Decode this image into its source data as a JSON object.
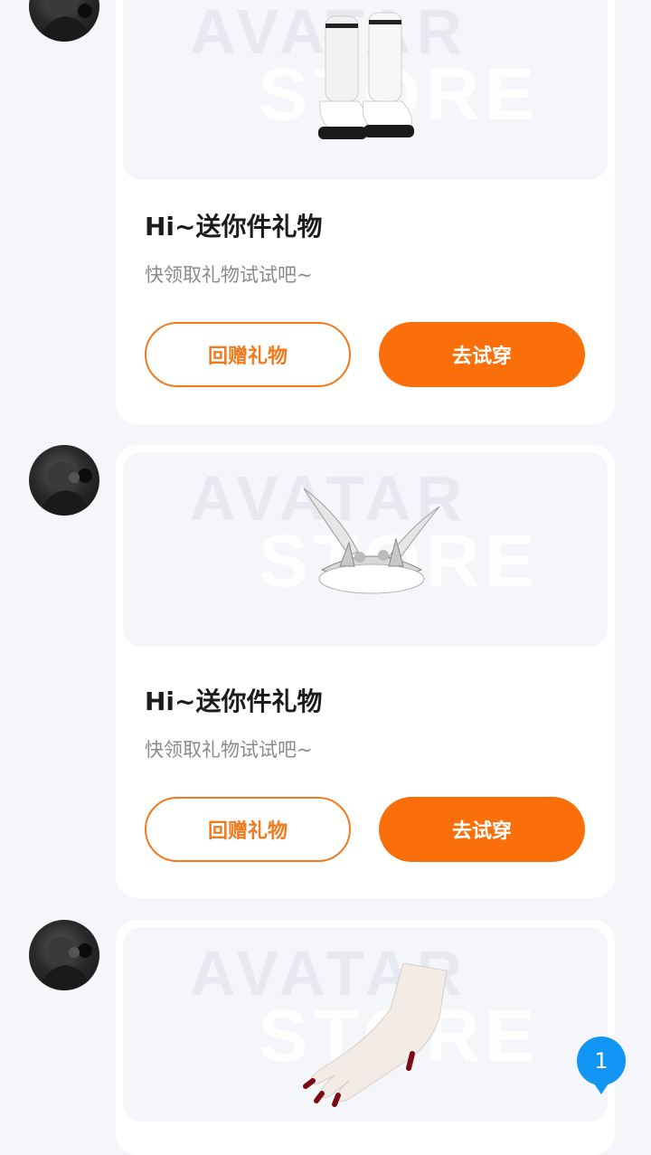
{
  "messages": [
    {
      "item_icon": "white-boots-icon",
      "title": "Hi~送你件礼物",
      "subtitle": "快领取礼物试试吧~",
      "return_gift_label": "回赠礼物",
      "try_on_label": "去试穿"
    },
    {
      "item_icon": "silver-wing-crown-icon",
      "title": "Hi~送你件礼物",
      "subtitle": "快领取礼物试试吧~",
      "return_gift_label": "回赠礼物",
      "try_on_label": "去试穿"
    },
    {
      "item_icon": "white-glove-icon"
    }
  ],
  "watermark": {
    "line1": "AVATAR",
    "line2": "STORE"
  },
  "unread_badge": {
    "count": "1"
  },
  "colors": {
    "accent": "#fb6f0b",
    "badge": "#1196f5",
    "background": "#f4f6f9"
  }
}
